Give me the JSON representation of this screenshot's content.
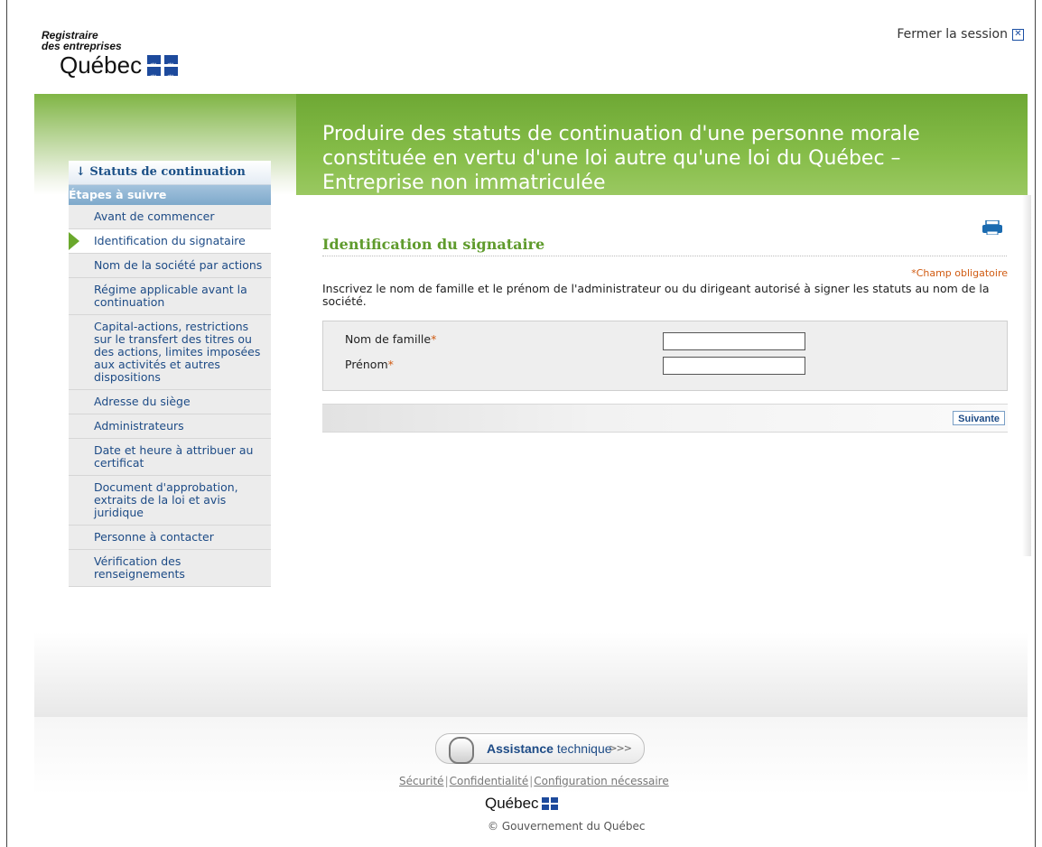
{
  "header": {
    "logo_line1": "Registraire",
    "logo_line2": "des entreprises",
    "logo_main": "Québec",
    "logout_label": "Fermer la session"
  },
  "title": "Produire des statuts de continuation d'une personne morale constituée en vertu d'une loi autre qu'une loi du Québec – Entreprise non immatriculée",
  "nav": {
    "header": "↓ Statuts de continuation",
    "steps_label": "Étapes à suivre",
    "items": [
      {
        "label": "Avant de commencer"
      },
      {
        "label": "Identification du signataire"
      },
      {
        "label": "Nom de la société par actions"
      },
      {
        "label": "Régime applicable avant la continuation"
      },
      {
        "label": "Capital-actions, restrictions sur le transfert des titres ou des actions, limites imposées aux activités et autres dispositions"
      },
      {
        "label": "Adresse du siège"
      },
      {
        "label": "Administrateurs"
      },
      {
        "label": "Date et heure à attribuer au certificat"
      },
      {
        "label": "Document d'approbation, extraits de la loi et avis juridique"
      },
      {
        "label": "Personne à contacter"
      },
      {
        "label": "Vérification des renseignements"
      }
    ],
    "active_index": 1
  },
  "main": {
    "section_title": "Identification du signataire",
    "required_note": "*Champ obligatoire",
    "instructions": "Inscrivez le nom de famille et le prénom de l'administrateur ou du dirigeant autorisé à signer les statuts au nom de la société.",
    "fields": {
      "last_name_label": "Nom de famille",
      "last_name_value": "",
      "first_name_label": "Prénom",
      "first_name_value": "",
      "required_star": "*"
    },
    "next_button": "Suivante"
  },
  "footer": {
    "assist_bold": "Assistance",
    "assist_rest": " technique",
    "assist_arrows": ">>>",
    "links": [
      "Sécurité",
      "Confidentialité",
      "Configuration nécessaire"
    ],
    "logo": "Québec",
    "copyright": "© Gouvernement du Québec"
  },
  "colors": {
    "brand_green": "#86bd49",
    "link_blue": "#1d4b86",
    "required_orange": "#d05b12",
    "section_green": "#5f9b2c"
  }
}
